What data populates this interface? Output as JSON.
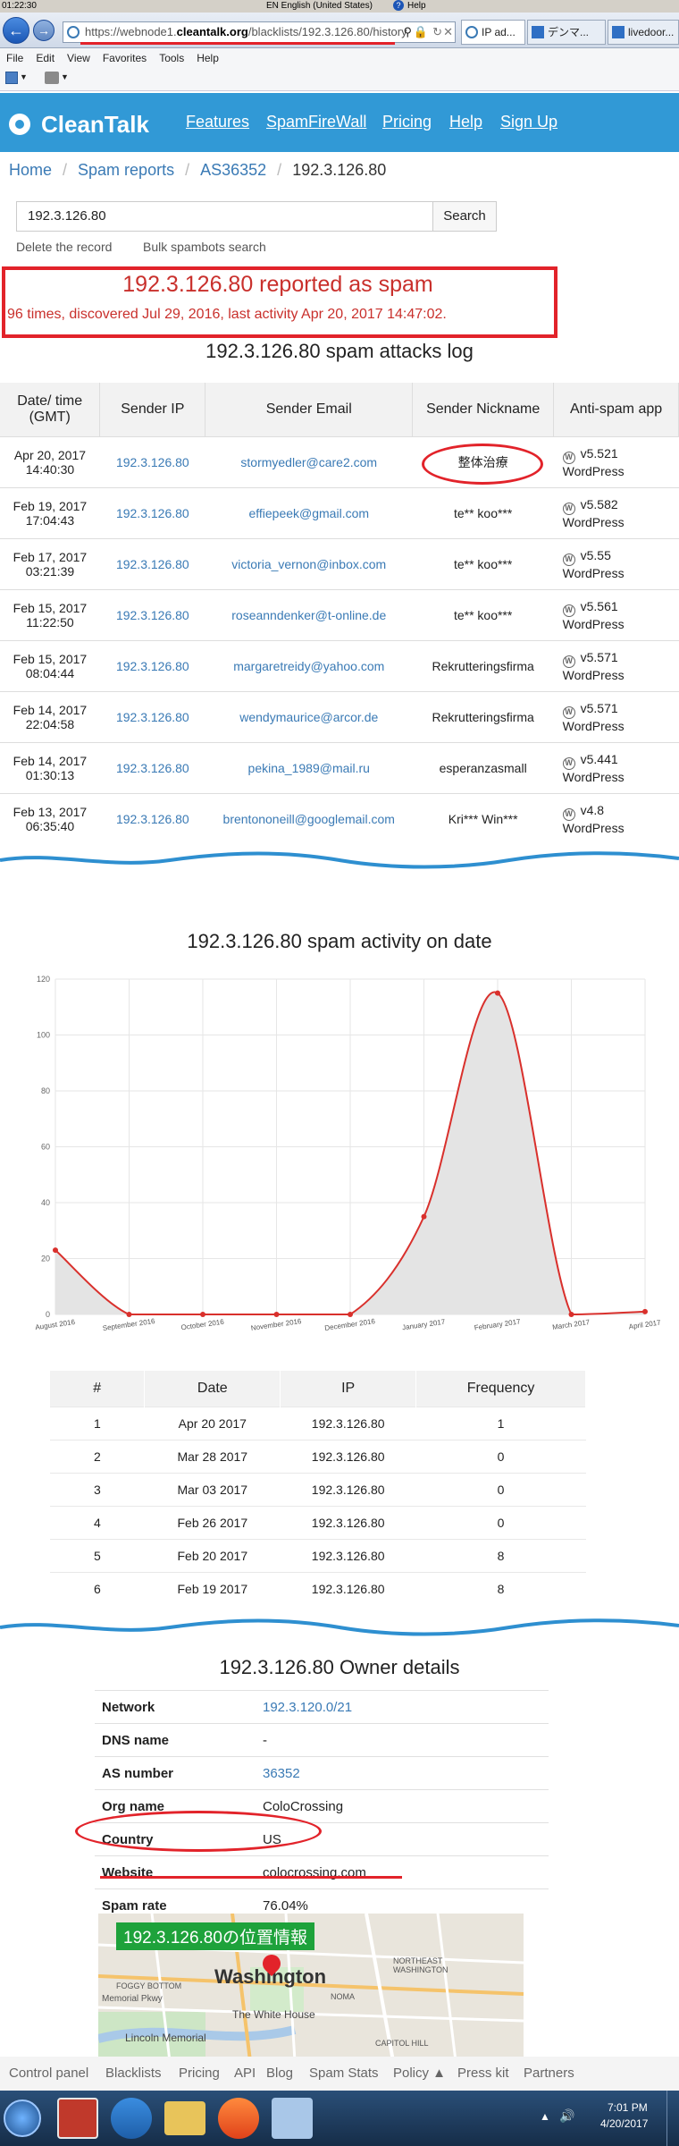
{
  "system_bar": {
    "time": "01:22:30",
    "language": "EN English (United States)",
    "help": "Help"
  },
  "browser": {
    "url_prefix": "https://webnode1.",
    "url_domain": "cleantalk.org",
    "url_path": "/blacklists/192.3.126.80/history",
    "tabs": [
      {
        "label": "IP ad..."
      },
      {
        "label": "デンマ..."
      },
      {
        "label": "livedoor..."
      }
    ],
    "menu": [
      "File",
      "Edit",
      "View",
      "Favorites",
      "Tools",
      "Help"
    ]
  },
  "site": {
    "logo": "CleanTalk",
    "nav": [
      "Features",
      "SpamFireWall",
      "Pricing",
      "Help",
      "Sign Up"
    ]
  },
  "breadcrumb": {
    "home": "Home",
    "reports": "Spam reports",
    "asn": "AS36352",
    "current": "192.3.126.80"
  },
  "search": {
    "value": "192.3.126.80",
    "button": "Search"
  },
  "actions": {
    "delete": "Delete the record",
    "bulk": "Bulk spambots search"
  },
  "summary": {
    "title": "192.3.126.80 reported as spam",
    "detail": "96 times, discovered Jul 29, 2016, last activity Apr 20, 2017 14:47:02."
  },
  "log": {
    "heading": "192.3.126.80 spam attacks log",
    "columns": [
      "Date/ time (GMT)",
      "Sender IP",
      "Sender Email",
      "Sender Nickname",
      "Anti-spam app"
    ],
    "rows": [
      {
        "date": "Apr 20, 2017",
        "time": "14:40:30",
        "ip": "192.3.126.80",
        "email": "stormyedler@care2.com",
        "nick": "整体治療",
        "ver": "v5.521",
        "app": "WordPress"
      },
      {
        "date": "Feb 19, 2017",
        "time": "17:04:43",
        "ip": "192.3.126.80",
        "email": "effiepeek@gmail.com",
        "nick": "te** koo***",
        "ver": "v5.582",
        "app": "WordPress"
      },
      {
        "date": "Feb 17, 2017",
        "time": "03:21:39",
        "ip": "192.3.126.80",
        "email": "victoria_vernon@inbox.com",
        "nick": "te** koo***",
        "ver": "v5.55",
        "app": "WordPress"
      },
      {
        "date": "Feb 15, 2017",
        "time": "11:22:50",
        "ip": "192.3.126.80",
        "email": "roseanndenker@t-online.de",
        "nick": "te** koo***",
        "ver": "v5.561",
        "app": "WordPress"
      },
      {
        "date": "Feb 15, 2017",
        "time": "08:04:44",
        "ip": "192.3.126.80",
        "email": "margaretreidy@yahoo.com",
        "nick": "Rekrutteringsfirma",
        "ver": "v5.571",
        "app": "WordPress"
      },
      {
        "date": "Feb 14, 2017",
        "time": "22:04:58",
        "ip": "192.3.126.80",
        "email": "wendymaurice@arcor.de",
        "nick": "Rekrutteringsfirma",
        "ver": "v5.571",
        "app": "WordPress"
      },
      {
        "date": "Feb 14, 2017",
        "time": "01:30:13",
        "ip": "192.3.126.80",
        "email": "pekina_1989@mail.ru",
        "nick": "esperanzasmall",
        "ver": "v5.441",
        "app": "WordPress"
      },
      {
        "date": "Feb 13, 2017",
        "time": "06:35:40",
        "ip": "192.3.126.80",
        "email": "brentononeill@googlemail.com",
        "nick": "Kri*** Win***",
        "ver": "v4.8",
        "app": "WordPress"
      }
    ]
  },
  "chart_data": {
    "type": "area",
    "title": "192.3.126.80 spam activity on date",
    "categories": [
      "August 2016",
      "September 2016",
      "October 2016",
      "November 2016",
      "December 2016",
      "January 2017",
      "February 2017",
      "March 2017",
      "April 2017"
    ],
    "values": [
      23,
      0,
      0,
      0,
      0,
      35,
      115,
      0,
      1
    ],
    "ylim": [
      0,
      120
    ],
    "yticks": [
      0,
      20,
      40,
      60,
      80,
      100,
      120
    ],
    "grid": true,
    "colors": {
      "line": "#d9302c",
      "fill": "#e4e4e4"
    }
  },
  "frequency": {
    "columns": [
      "#",
      "Date",
      "IP",
      "Frequency"
    ],
    "rows": [
      {
        "n": "1",
        "date": "Apr 20 2017",
        "ip": "192.3.126.80",
        "freq": "1"
      },
      {
        "n": "2",
        "date": "Mar 28 2017",
        "ip": "192.3.126.80",
        "freq": "0"
      },
      {
        "n": "3",
        "date": "Mar 03 2017",
        "ip": "192.3.126.80",
        "freq": "0"
      },
      {
        "n": "4",
        "date": "Feb 26 2017",
        "ip": "192.3.126.80",
        "freq": "0"
      },
      {
        "n": "5",
        "date": "Feb 20 2017",
        "ip": "192.3.126.80",
        "freq": "8"
      },
      {
        "n": "6",
        "date": "Feb 19 2017",
        "ip": "192.3.126.80",
        "freq": "8"
      }
    ]
  },
  "owner": {
    "heading": "192.3.126.80 Owner details",
    "network_label": "Network",
    "network": "192.3.120.0/21",
    "dns_label": "DNS name",
    "dns": "-",
    "as_label": "AS number",
    "as": "36352",
    "org_label": "Org name",
    "org": "ColoCrossing",
    "country_label": "Country",
    "country": "US",
    "website_label": "Website",
    "website": "colocrossing.com",
    "rate_label": "Spam rate",
    "rate": "76.04%"
  },
  "map": {
    "label": "192.3.126.80の位置情報",
    "city": "Washington",
    "places": [
      "The White House",
      "Lincoln Memorial",
      "NORTHEAST WASHINGTON",
      "NOMA",
      "CAPITOL HILL",
      "FOGGY BOTTOM",
      "Memorial Pkwy"
    ]
  },
  "footer": {
    "links": [
      "Control panel",
      "Blacklists",
      "Pricing",
      "API",
      "Blog",
      "Spam Stats",
      "Policy ▲",
      "Press kit",
      "Partners"
    ]
  },
  "taskbar": {
    "time": "7:01 PM",
    "date": "4/20/2017"
  }
}
